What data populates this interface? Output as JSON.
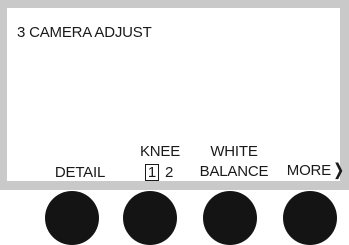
{
  "display": {
    "menu_title": "3 CAMERA ADJUST"
  },
  "softkeys": {
    "detail": "DETAIL",
    "knee": {
      "label": "KNEE",
      "options": [
        "1",
        "2"
      ],
      "selected": "1"
    },
    "white_balance": {
      "line1": "WHITE",
      "line2": "BALANCE"
    },
    "more": {
      "label": "MORE",
      "arrow": "❭"
    }
  },
  "knobs": [
    {
      "name": "knob-1"
    },
    {
      "name": "knob-2"
    },
    {
      "name": "knob-3"
    },
    {
      "name": "knob-4"
    }
  ],
  "colors": {
    "panel": "#c9c9c9",
    "screen": "#ffffff",
    "knob": "#141414",
    "text": "#1a1a1a"
  }
}
